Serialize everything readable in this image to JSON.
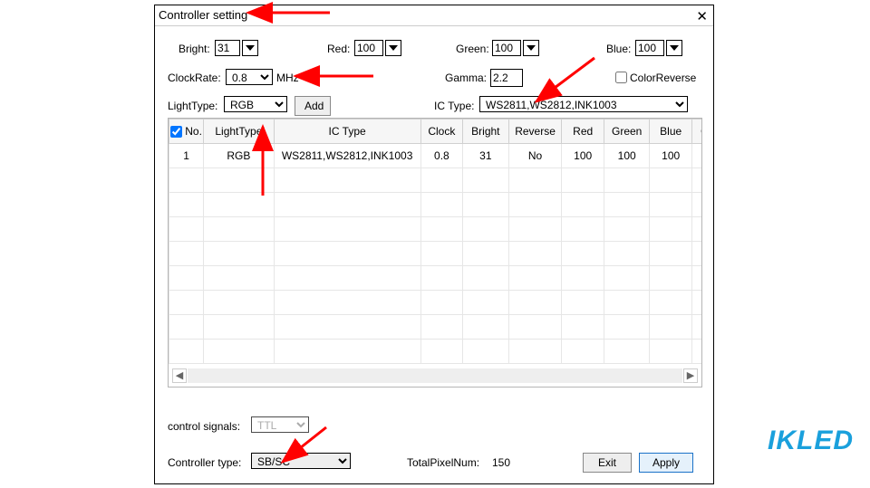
{
  "window": {
    "title": "Controller setting"
  },
  "row1": {
    "bright_label": "Bright:",
    "bright_value": "31",
    "red_label": "Red:",
    "red_value": "100",
    "green_label": "Green:",
    "green_value": "100",
    "blue_label": "Blue:",
    "blue_value": "100"
  },
  "row2": {
    "clockrate_label": "ClockRate:",
    "clockrate_value": "0.8",
    "mhz_label": "MHz",
    "gamma_label": "Gamma:",
    "gamma_value": "2.2",
    "color_reverse_label": "ColorReverse"
  },
  "row3": {
    "lighttype_label": "LightType:",
    "lighttype_value": "RGB",
    "add_label": "Add",
    "ictype_label": "IC Type:",
    "ictype_value": "WS2811,WS2812,INK1003"
  },
  "table": {
    "headers": [
      "No.",
      "LightType",
      "IC Type",
      "Clock",
      "Bright",
      "Reverse",
      "Red",
      "Green",
      "Blue",
      "G:"
    ],
    "rows": [
      {
        "no": "1",
        "lighttype": "RGB",
        "ictype": "WS2811,WS2812,INK1003",
        "clock": "0.8",
        "bright": "31",
        "reverse": "No",
        "red": "100",
        "green": "100",
        "blue": "100"
      }
    ]
  },
  "footer": {
    "control_signals_label": "control signals:",
    "control_signals_value": "TTL",
    "controller_type_label": "Controller type:",
    "controller_type_value": "SB/SC",
    "total_pixel_label": "TotalPixelNum:",
    "total_pixel_value": "150",
    "exit_label": "Exit",
    "apply_label": "Apply"
  },
  "watermark": "IKLED"
}
